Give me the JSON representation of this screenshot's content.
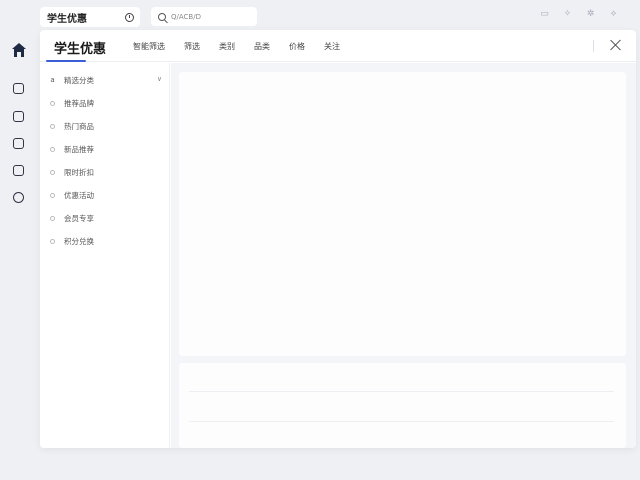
{
  "topbar": {
    "app_title": "学生优惠",
    "search_placeholder": "Q/ACB/D"
  },
  "rail": {
    "items": [
      "home-icon",
      "clock-icon",
      "note-icon",
      "layers-icon",
      "list-icon",
      "help-icon"
    ]
  },
  "panel": {
    "title": "学生优惠",
    "tabs": [
      "智能筛选",
      "筛选",
      "类别",
      "品类",
      "价格",
      "关注"
    ],
    "sidebar": [
      {
        "label": "精选分类",
        "icon": "a"
      },
      {
        "label": "推荐品牌"
      },
      {
        "label": "热门商品"
      },
      {
        "label": "新品推荐"
      },
      {
        "label": "限时折扣"
      },
      {
        "label": "优惠活动"
      },
      {
        "label": "会员专享"
      },
      {
        "label": "积分兑换"
      }
    ]
  },
  "colors": {
    "accent": "#3a5fd9",
    "background": "#eef0f4"
  }
}
